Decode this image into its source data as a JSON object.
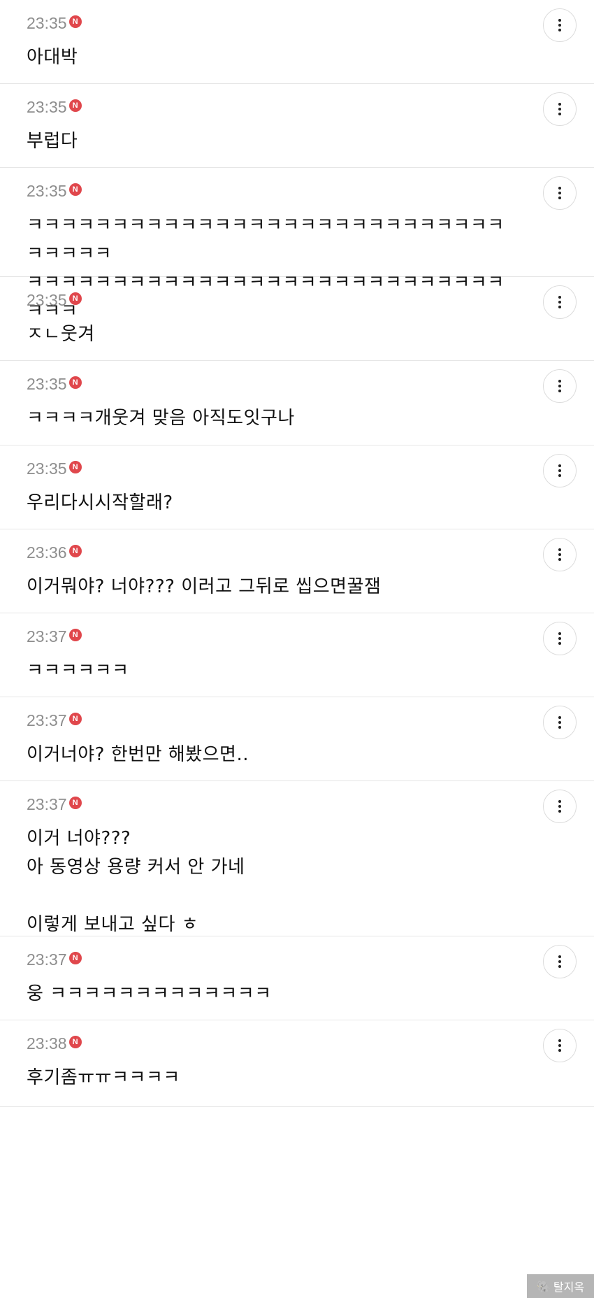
{
  "comments": [
    {
      "time": "23:35",
      "badge": "N",
      "text": "아대박",
      "h": 120
    },
    {
      "time": "23:35",
      "badge": "N",
      "text": "부럽다",
      "h": 120
    },
    {
      "time": "23:35",
      "badge": "N",
      "text": "ㅋㅋㅋㅋㅋㅋㅋㅋㅋㅋㅋㅋㅋㅋㅋㅋㅋㅋㅋㅋㅋㅋㅋㅋㅋㅋㅋㅋㅋㅋㅋㅋㅋ\nㅋㅋㅋㅋㅋㅋㅋㅋㅋㅋㅋㅋㅋㅋㅋㅋㅋㅋㅋㅋㅋㅋㅋㅋㅋㅋㅋㅋㅋㅋㅋ",
      "h": 156
    },
    {
      "time": "23:35",
      "badge": "N",
      "text": "ㅈㄴ웃겨",
      "h": 120
    },
    {
      "time": "23:35",
      "badge": "N",
      "text": "ㅋㅋㅋㅋ개웃겨 맞음 아직도잇구나",
      "h": 121
    },
    {
      "time": "23:35",
      "badge": "N",
      "text": "우리다시시작할래?",
      "h": 120
    },
    {
      "time": "23:36",
      "badge": "N",
      "text": "이거뭐야? 너야??? 이러고 그뒤로 씹으면꿀잼",
      "h": 120
    },
    {
      "time": "23:37",
      "badge": "N",
      "text": "ㅋㅋㅋㅋㅋㅋ",
      "h": 120
    },
    {
      "time": "23:37",
      "badge": "N",
      "text": "이거너야? 한번만 해봤으면..",
      "h": 120
    },
    {
      "time": "23:37",
      "badge": "N",
      "text": "이거 너야???\n아 동영상 용량 커서 안 가네\n\n이렇게 보내고 싶다 ㅎ",
      "h": 222
    },
    {
      "time": "23:37",
      "badge": "N",
      "text": "웅 ㅋㅋㅋㅋㅋㅋㅋㅋㅋㅋㅋㅋㅋ",
      "h": 120
    },
    {
      "time": "23:38",
      "badge": "N",
      "text": "후기좀ㅠㅠㅋㅋㅋㅋ",
      "h": 124
    }
  ],
  "watermark": {
    "logo": "🐘",
    "text": "탈지옥"
  }
}
